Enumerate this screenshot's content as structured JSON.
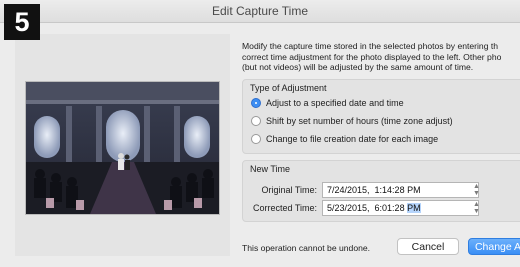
{
  "step_number": "5",
  "window": {
    "title": "Edit Capture Time"
  },
  "intro_text": "Modify the capture time stored in the selected photos by entering th\ncorrect time adjustment for the photo displayed to the left. Other pho\n(but not videos) will be adjusted by the same amount of time.",
  "adjustment": {
    "title": "Type of Adjustment",
    "options": [
      {
        "label": "Adjust to a specified date and time",
        "selected": true
      },
      {
        "label": "Shift by set number of hours (time zone adjust)",
        "selected": false
      },
      {
        "label": "Change to file creation date for each image",
        "selected": false
      }
    ]
  },
  "new_time": {
    "title": "New Time",
    "original_label": "Original Time:",
    "original_value": "7/24/2015,  1:14:28 PM",
    "corrected_label": "Corrected Time:",
    "corrected_value_main": "5/23/2015,  6:01:28 ",
    "corrected_value_selected": "PM"
  },
  "footer": {
    "note": "This operation cannot be undone.",
    "cancel_label": "Cancel",
    "change_label": "Change A"
  },
  "colors": {
    "accent": "#3a8ef5",
    "selection": "#b5d4fb"
  }
}
